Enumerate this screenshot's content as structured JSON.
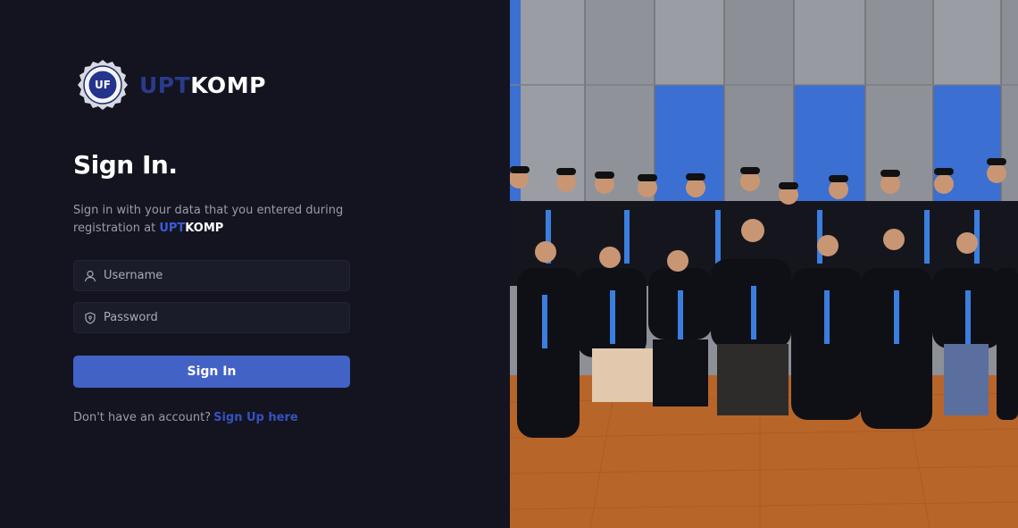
{
  "brand": {
    "name_part1": "UPT",
    "name_part2": "KOMP",
    "logo_letters": "UF"
  },
  "signin": {
    "title": "Sign In.",
    "description_prefix": "Sign in with your data that you entered during registration at ",
    "description_brand_part1": "UPT",
    "description_brand_part2": "KOMP",
    "username_placeholder": "Username",
    "password_placeholder": "Password",
    "submit_label": "Sign In",
    "no_account_text": "Don't have an account?",
    "signup_link": "Sign Up here"
  },
  "photo": {
    "alt": ""
  },
  "colors": {
    "background": "#13141f",
    "accent": "#4262c5",
    "brand_blue": "#2a3a8c",
    "link": "#3552c0"
  }
}
